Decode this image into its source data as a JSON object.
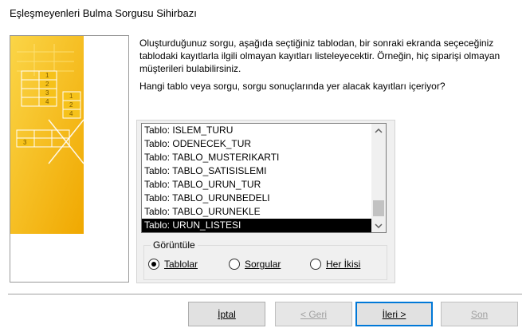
{
  "window": {
    "title": "Eşleşmeyenleri Bulma Sorgusu Sihirbazı"
  },
  "illustration": {
    "cells_left": [
      "1",
      "2",
      "3",
      "4"
    ],
    "cells_right": [
      "1",
      "2",
      "4"
    ],
    "cell_bottom": "3"
  },
  "description": "Oluşturduğunuz sorgu, aşağıda seçtiğiniz tablodan, bir sonraki ekranda seçeceğiniz tablodaki kayıtlarla ilgili olmayan kayıtları listeleyecektir. Örneğin, hiç siparişi olmayan müşterileri bulabilirsiniz.",
  "question": "Hangi tablo veya sorgu, sorgu sonuçlarında yer alacak kayıtları içeriyor?",
  "list": {
    "items": [
      "Tablo: ISLEM_TURU",
      "Tablo: ODENECEK_TUR",
      "Tablo: TABLO_MUSTERIKARTI",
      "Tablo: TABLO_SATISISLEMI",
      "Tablo: TABLO_URUN_TUR",
      "Tablo: TABLO_URUNBEDELI",
      "Tablo: TABLO_URUNEKLE",
      "Tablo: URUN_LISTESI"
    ],
    "selected_index": 7
  },
  "view": {
    "label": "Görüntüle",
    "options": [
      "Tablolar",
      "Sorgular",
      "Her İkisi"
    ],
    "selected": "Tablolar"
  },
  "buttons": {
    "cancel": "İptal",
    "back": "< Geri",
    "next": "İleri >",
    "finish": "Son"
  }
}
